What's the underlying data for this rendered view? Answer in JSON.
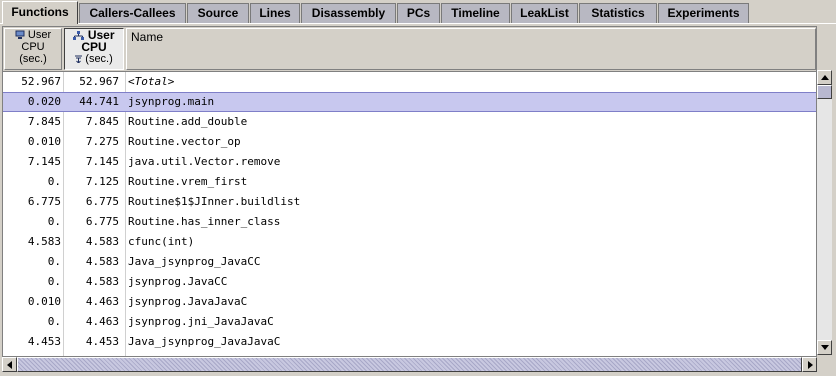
{
  "tabs": [
    {
      "label": "Functions",
      "active": true
    },
    {
      "label": "Callers-Callees"
    },
    {
      "label": "Source"
    },
    {
      "label": "Lines"
    },
    {
      "label": "Disassembly"
    },
    {
      "label": "PCs"
    },
    {
      "label": "Timeline"
    },
    {
      "label": "LeakList"
    },
    {
      "label": "Statistics"
    },
    {
      "label": "Experiments"
    }
  ],
  "table": {
    "headers": {
      "col1": {
        "line1": "User",
        "line2": "CPU",
        "line3": "(sec.)",
        "icon": "exclusive-metric-icon"
      },
      "col2": {
        "line1": "User",
        "line2": "CPU",
        "line3": "(sec.)",
        "icon": "inclusive-metric-icon",
        "sort_icon": "sort-descending-icon",
        "sorted": true
      },
      "col3": {
        "label": "Name"
      }
    },
    "rows": [
      {
        "excl": "52.967",
        "incl": "52.967",
        "name": "<Total>"
      },
      {
        "excl": "0.020",
        "incl": "44.741",
        "name": "jsynprog.main",
        "selected": true
      },
      {
        "excl": "7.845",
        "incl": "7.845",
        "name": "Routine.add_double"
      },
      {
        "excl": "0.010",
        "incl": "7.275",
        "name": "Routine.vector_op"
      },
      {
        "excl": "7.145",
        "incl": "7.145",
        "name": "java.util.Vector.remove"
      },
      {
        "excl": "0.",
        "incl": "7.125",
        "name": "Routine.vrem_first"
      },
      {
        "excl": "6.775",
        "incl": "6.775",
        "name": "Routine$1$JInner.buildlist"
      },
      {
        "excl": "0.",
        "incl": "6.775",
        "name": "Routine.has_inner_class"
      },
      {
        "excl": "4.583",
        "incl": "4.583",
        "name": "cfunc(int)"
      },
      {
        "excl": "0.",
        "incl": "4.583",
        "name": "Java_jsynprog_JavaCC"
      },
      {
        "excl": "0.",
        "incl": "4.583",
        "name": "jsynprog.JavaCC"
      },
      {
        "excl": "0.010",
        "incl": "4.463",
        "name": "jsynprog.JavaJavaC"
      },
      {
        "excl": "0.",
        "incl": "4.463",
        "name": "jsynprog.jni_JavaJavaC"
      },
      {
        "excl": "4.453",
        "incl": "4.453",
        "name": "Java_jsynprog_JavaJavaC"
      }
    ]
  },
  "colors": {
    "selection": "#c8c8ef",
    "tab_inactive": "#b8b8c2",
    "panel": "#d4d0c8"
  }
}
